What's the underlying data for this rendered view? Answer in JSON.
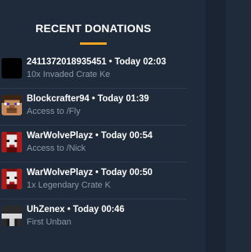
{
  "widget": {
    "title": "RECENT DONATIONS",
    "accent_color": "#f5a623",
    "items": [
      {
        "avatar_icon": "blank-avatar-icon",
        "heading": "2411372018935451 • Today 02:03",
        "detail": "10x Invaded Crate Ke"
      },
      {
        "avatar_icon": "steve-avatar-icon",
        "heading": "Blockcrafter94 • Today 01:39",
        "detail": "Access to /Fly"
      },
      {
        "avatar_icon": "redskin-avatar-icon",
        "heading": "WarWolvePlayz • Today 00:54",
        "detail": "Access to /Nick"
      },
      {
        "avatar_icon": "redskin-avatar-icon",
        "heading": "WarWolvePlayz • Today 00:50",
        "detail": "1x Legendary Crate K"
      },
      {
        "avatar_icon": "dark-avatar-icon",
        "heading": "UhZenex • Today 00:46",
        "detail": "First Unban"
      }
    ]
  }
}
